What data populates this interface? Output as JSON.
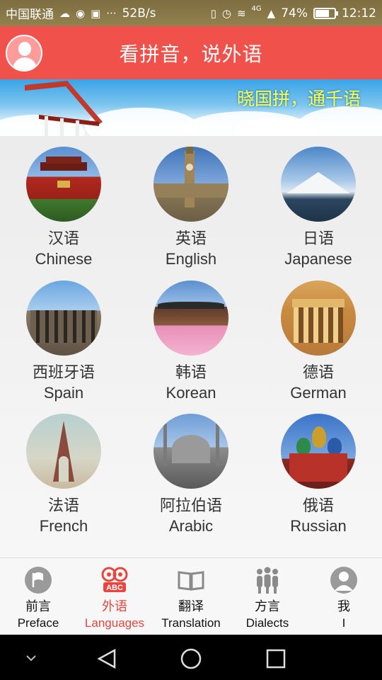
{
  "status_bar": {
    "carrier": "中国联通",
    "net_speed": "52B/s",
    "signal_label": "4G",
    "battery": "74%",
    "battery_level": 0.74,
    "time": "12:12"
  },
  "header": {
    "title": "看拼音，说外语"
  },
  "banner": {
    "slogan": "晓国拼，通千语"
  },
  "languages": [
    {
      "cn": "汉语",
      "en": "Chinese",
      "image": "tiananmen"
    },
    {
      "cn": "英语",
      "en": "English",
      "image": "big-ben"
    },
    {
      "cn": "日语",
      "en": "Japanese",
      "image": "mount-fuji"
    },
    {
      "cn": "西班牙语",
      "en": "Spain",
      "image": "colosseum"
    },
    {
      "cn": "韩语",
      "en": "Korean",
      "image": "korean-palace"
    },
    {
      "cn": "德语",
      "en": "German",
      "image": "brandenburg-gate"
    },
    {
      "cn": "法语",
      "en": "French",
      "image": "eiffel-tower"
    },
    {
      "cn": "阿拉伯语",
      "en": "Arabic",
      "image": "mosque"
    },
    {
      "cn": "俄语",
      "en": "Russian",
      "image": "st-basils"
    }
  ],
  "tabs": [
    {
      "cn": "前言",
      "en": "Preface",
      "icon": "flag-icon",
      "active": false
    },
    {
      "cn": "外语",
      "en": "Languages",
      "icon": "abc-owl-icon",
      "active": true
    },
    {
      "cn": "翻译",
      "en": "Translation",
      "icon": "book-icon",
      "active": false
    },
    {
      "cn": "方言",
      "en": "Dialects",
      "icon": "people-icon",
      "active": false
    },
    {
      "cn": "我",
      "en": "I",
      "icon": "user-icon",
      "active": false
    }
  ],
  "colors": {
    "header_bg": "#f0514a",
    "active_tab": "#e9453f",
    "slogan": "#ffff44"
  }
}
